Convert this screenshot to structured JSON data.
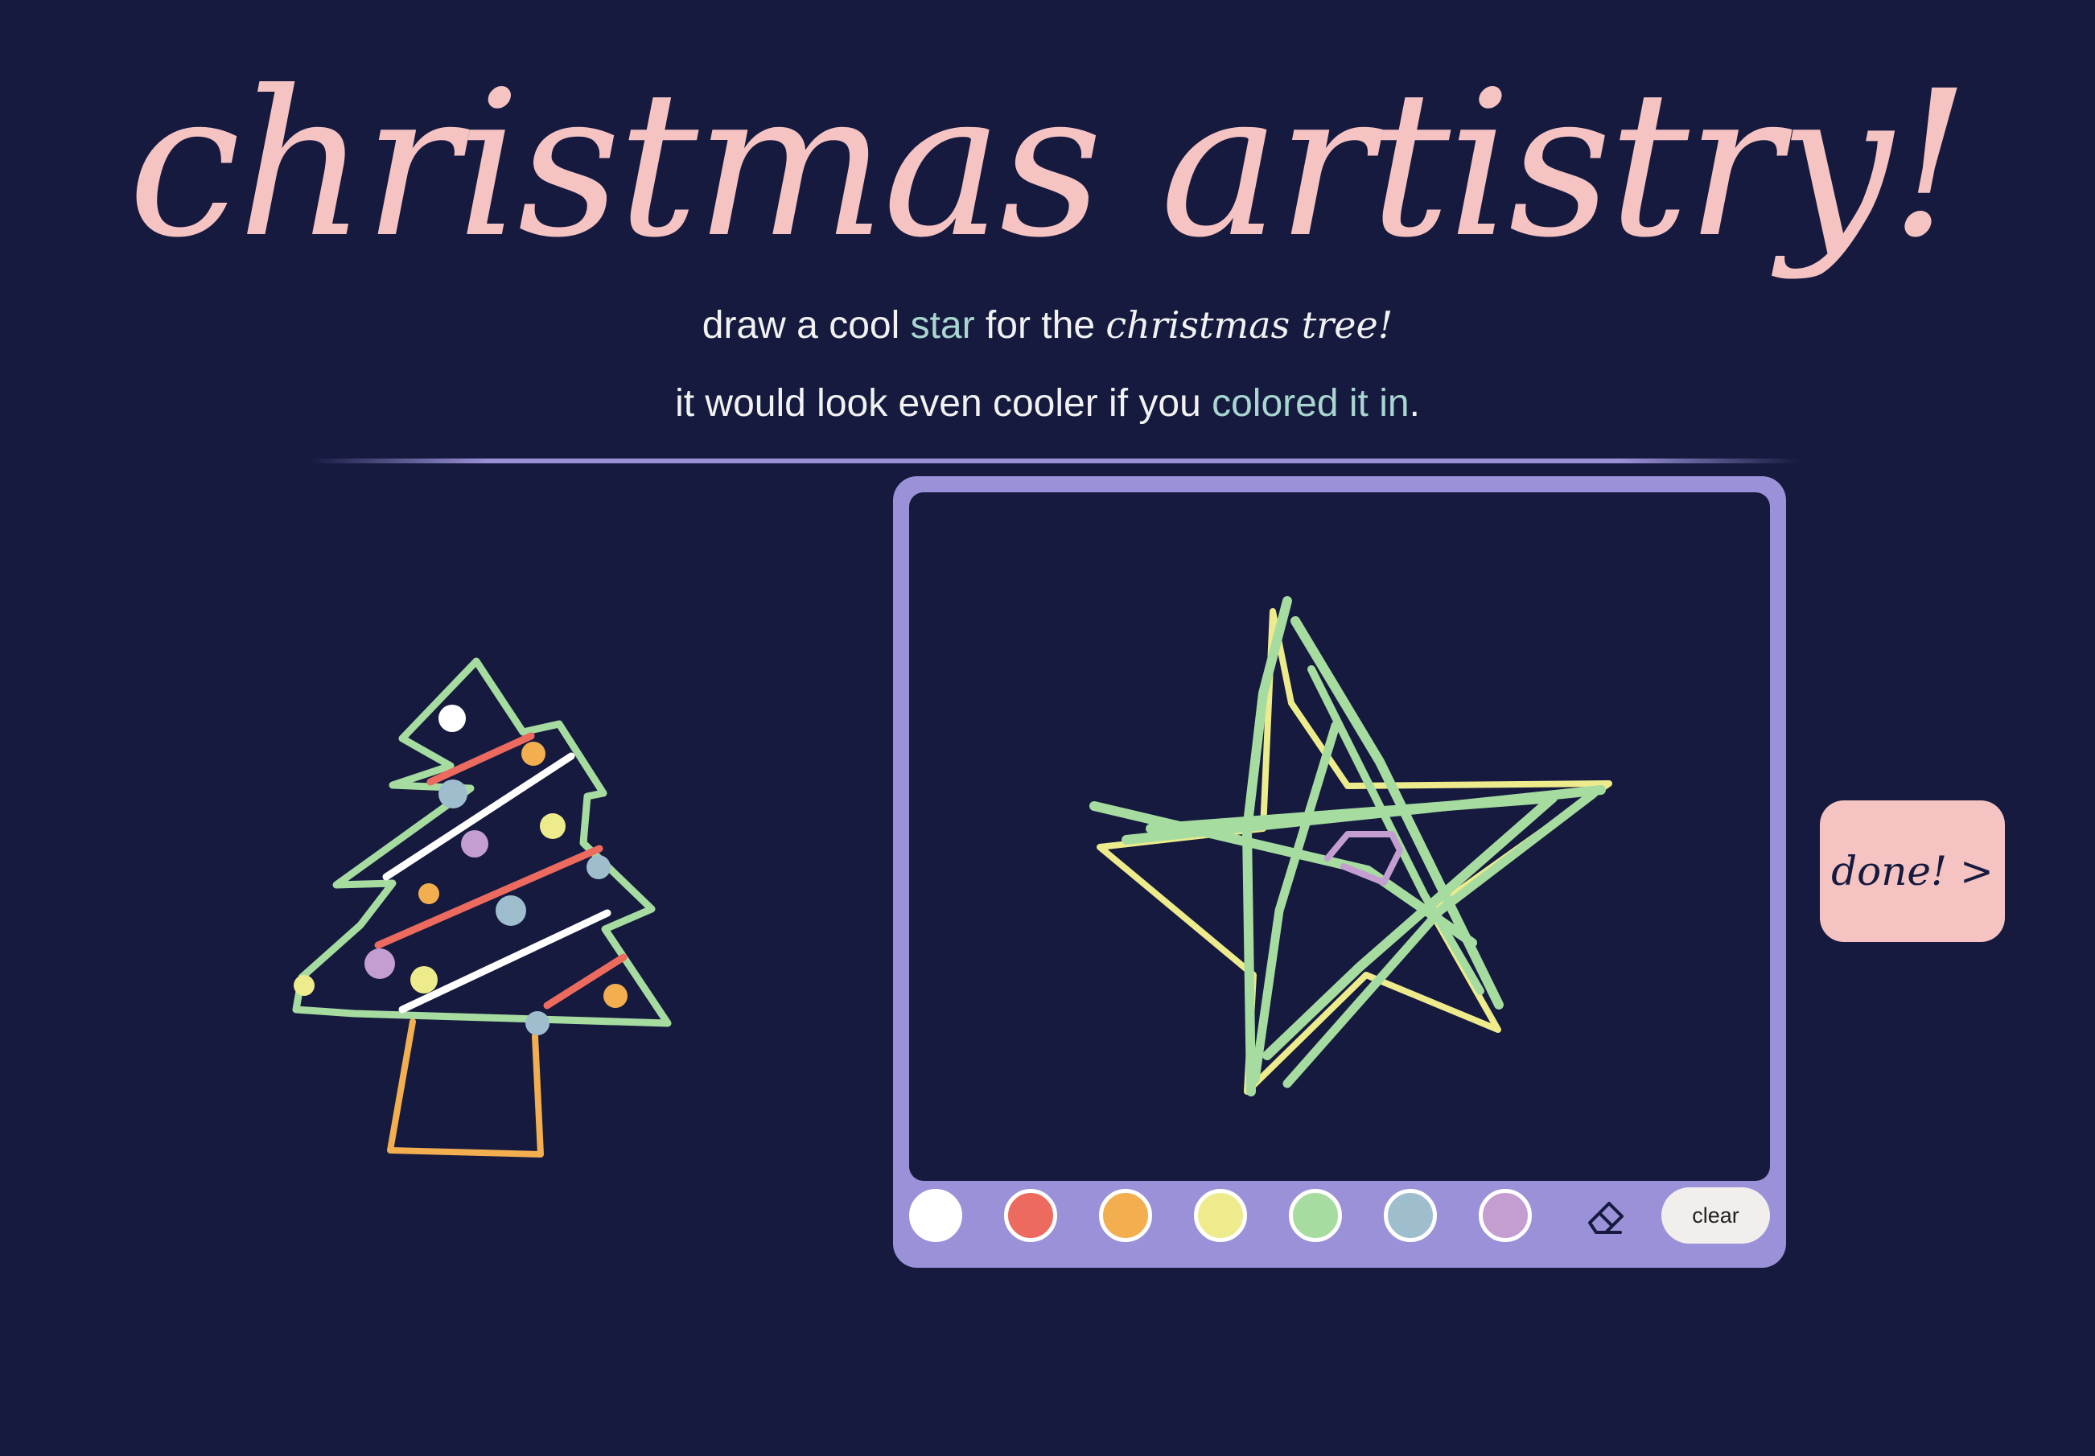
{
  "header": {
    "title": "christmas artistry!",
    "line1": {
      "part1": "draw a cool ",
      "accent": "star",
      "part2": " for the ",
      "hand": "christmas tree!"
    },
    "line2": {
      "part1": "it would look even cooler if you ",
      "accent": "colored it in",
      "part2": "."
    }
  },
  "palette": [
    {
      "name": "white",
      "color": "#ffffff"
    },
    {
      "name": "red",
      "color": "#ec6a5e"
    },
    {
      "name": "orange",
      "color": "#f2ae4f"
    },
    {
      "name": "yellow",
      "color": "#edeb8c"
    },
    {
      "name": "green",
      "color": "#a6dca0"
    },
    {
      "name": "blue",
      "color": "#9fbecd"
    },
    {
      "name": "purple",
      "color": "#c59ed1"
    }
  ],
  "tools": {
    "eraser_icon": "eraser-icon",
    "clear_label": "clear"
  },
  "done_label": "done! >",
  "colors": {
    "background": "#151a3e",
    "accent_pink": "#f6c3c3",
    "accent_teal": "#a9d6d1",
    "frame_purple": "#9a91d9"
  }
}
